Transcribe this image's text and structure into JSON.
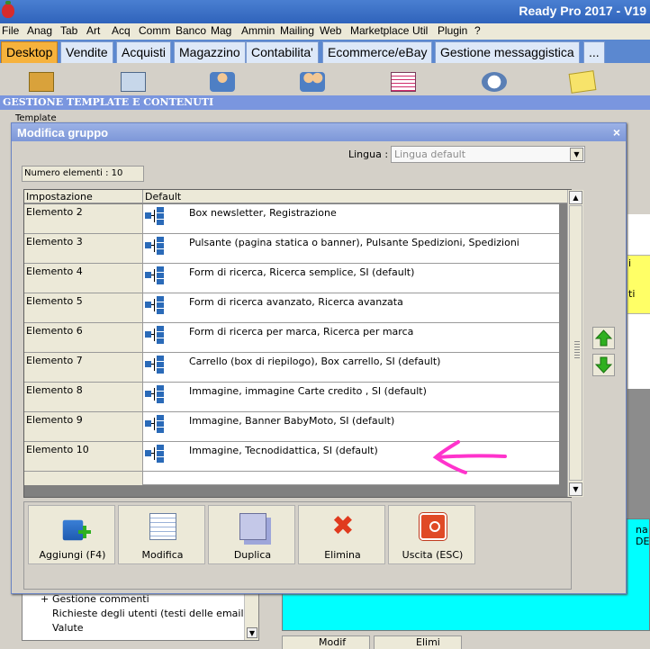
{
  "window": {
    "title": "Ready Pro 2017 - V19"
  },
  "menu": [
    "File",
    "Anag",
    "Tab",
    "Art",
    "Acq",
    "Comm",
    "Banco",
    "Mag",
    "Ammin",
    "Mailing",
    "Web",
    "Marketplace",
    "Util",
    "Plugin",
    "?"
  ],
  "tabs": [
    {
      "label": "Desktop",
      "active": true
    },
    {
      "label": "Vendite"
    },
    {
      "label": "Acquisti"
    },
    {
      "label": "Magazzino"
    },
    {
      "label": "Contabilita'"
    },
    {
      "label": "Ecommerce/eBay"
    },
    {
      "label": "Gestione messaggistica"
    },
    {
      "label": "..."
    }
  ],
  "section": {
    "title": "GESTIONE TEMPLATE E CONTENUTI"
  },
  "background": {
    "template_label": "Template",
    "tree_items": [
      "Gestione commenti",
      "Richieste degli utenti (testi delle email)",
      "Valute"
    ],
    "tree_expander": "+",
    "right_text": "na DE",
    "right_letter_1": "i",
    "right_letter_2": "ti",
    "bottom_btn_1": "Modif",
    "bottom_btn_2": "Elimi"
  },
  "dialog": {
    "title": "Modifica gruppo",
    "close_glyph": "×",
    "language_label": "Lingua :",
    "language_value": "Lingua default",
    "count_label": "Numero elementi : 10",
    "columns": [
      "Impostazione",
      "Default"
    ],
    "rows": [
      {
        "name": "Elemento 2",
        "value": "Box newsletter, Registrazione"
      },
      {
        "name": "Elemento 3",
        "value": "Pulsante (pagina statica o banner), Pulsante Spedizioni, Spedizioni"
      },
      {
        "name": "Elemento 4",
        "value": "Form di ricerca, Ricerca semplice, SI (default)"
      },
      {
        "name": "Elemento 5",
        "value": "Form di ricerca avanzato, Ricerca avanzata"
      },
      {
        "name": "Elemento 6",
        "value": "Form di ricerca per marca, Ricerca per marca"
      },
      {
        "name": "Elemento 7",
        "value": "Carrello (box di riepilogo), Box carrello, SI (default)"
      },
      {
        "name": "Elemento 8",
        "value": "Immagine, immagine Carte credito , SI (default)"
      },
      {
        "name": "Elemento 9",
        "value": "Immagine, Banner BabyMoto, SI (default)"
      },
      {
        "name": "Elemento 10",
        "value": "Immagine, Tecnodidattica, SI (default)"
      }
    ],
    "actions": [
      {
        "label": "Aggiungi (F4)",
        "icon": "add-icon"
      },
      {
        "label": "Modifica",
        "icon": "edit-icon"
      },
      {
        "label": "Duplica",
        "icon": "duplicate-icon"
      },
      {
        "label": "Elimina",
        "icon": "delete-icon"
      },
      {
        "label": "Uscita (ESC)",
        "icon": "exit-icon"
      }
    ]
  },
  "colors": {
    "title_bar": "#2f63bb",
    "active_tab": "#f6b23c",
    "dialog_title": "#7d97d8",
    "annotation_arrow": "#ff33cc"
  }
}
